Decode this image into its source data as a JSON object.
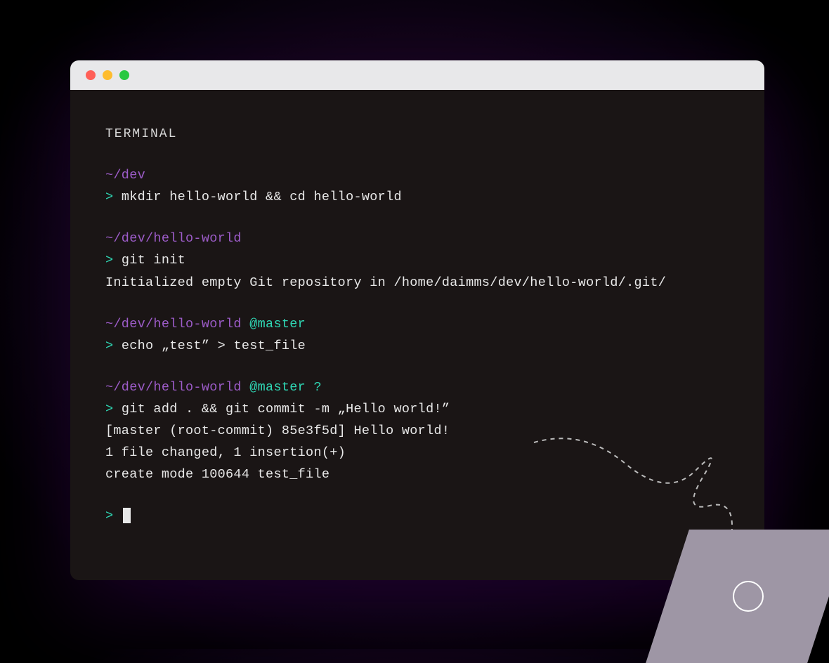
{
  "terminal": {
    "label": "TERMINAL",
    "blocks": [
      {
        "path": "~/dev",
        "branch": "",
        "caret": ">",
        "command": "mkdir hello-world && cd hello-world",
        "output": []
      },
      {
        "path": "~/dev/hello-world",
        "branch": "",
        "caret": ">",
        "command": "git init",
        "output": [
          "Initialized empty Git repository in /home/daimms/dev/hello-world/.git/"
        ]
      },
      {
        "path": "~/dev/hello-world",
        "branch": "@master",
        "caret": ">",
        "command": "echo „test” > test_file",
        "output": []
      },
      {
        "path": "~/dev/hello-world",
        "branch": "@master ?",
        "caret": ">",
        "command": "git add . && git commit -m „Hello world!”",
        "output": [
          "[master (root-commit) 85e3f5d] Hello world!",
          "1 file changed, 1 insertion(+)",
          "create mode 100644 test_file"
        ]
      }
    ],
    "active_prompt": {
      "caret": ">"
    }
  },
  "colors": {
    "path": "#9d5cc9",
    "branch": "#2fd8b5",
    "caret": "#2fd8b5",
    "text": "#e8e8e8",
    "bg": "#1a1515"
  }
}
